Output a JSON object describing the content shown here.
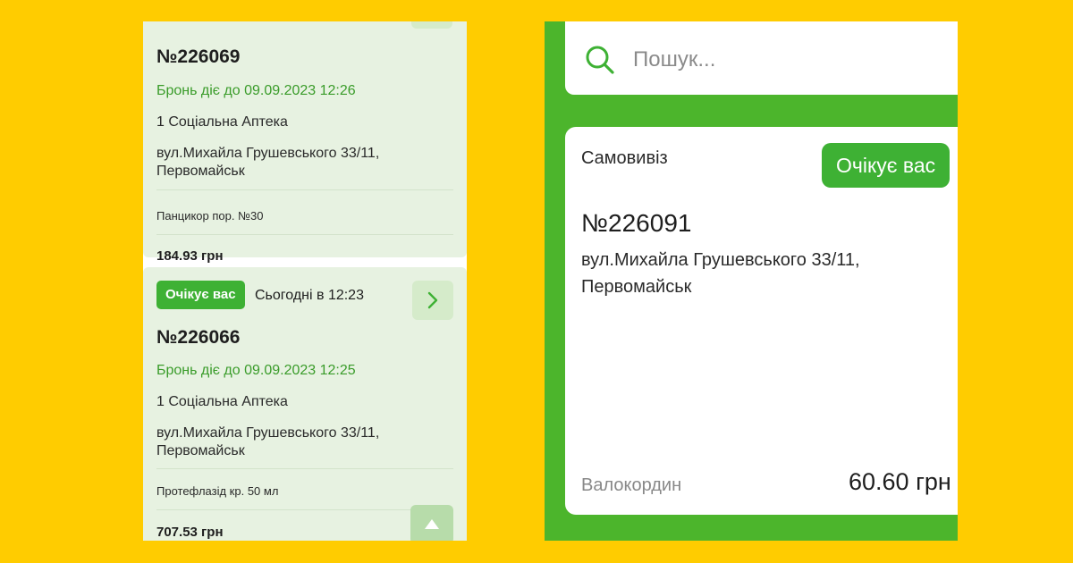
{
  "left_screen": {
    "orders": [
      {
        "number": "№226069",
        "reservation": "Бронь діє до 09.09.2023 12:26",
        "pharmacy": "1 Соціальна Аптека",
        "address_line1": "вул.Михайла Грушевського 33/11,",
        "address_line2": "Первомайськ",
        "product": "Панцикор пор. №30",
        "price": "184.93 грн"
      },
      {
        "status": "Очікує вас",
        "time": "Сьогодні в 12:23",
        "number": "№226066",
        "reservation": "Бронь діє до 09.09.2023 12:25",
        "pharmacy": "1 Соціальна Аптека",
        "address_line1": "вул.Михайла Грушевського 33/11,",
        "address_line2": "Первомайськ",
        "product": "Протефлазід кр. 50 мл",
        "price": "707.53 грн"
      }
    ]
  },
  "right_screen": {
    "search": {
      "placeholder": "Пошук..."
    },
    "order": {
      "delivery_type": "Самовивіз",
      "status": "Очікує вас",
      "number": "№226091",
      "address_line1": "вул.Михайла Грушевського 33/11,",
      "address_line2": "Первомайськ",
      "product": "Валокордин",
      "price": "60.60 грн"
    }
  },
  "colors": {
    "background": "#ffcc00",
    "card_green": "#e7f2e1",
    "accent_green": "#3eb134",
    "panel_green": "#4cb52c",
    "reserve_text": "#3a9c2a"
  },
  "icons": [
    "search-icon",
    "chevron-right-icon",
    "arrow-up-icon"
  ]
}
